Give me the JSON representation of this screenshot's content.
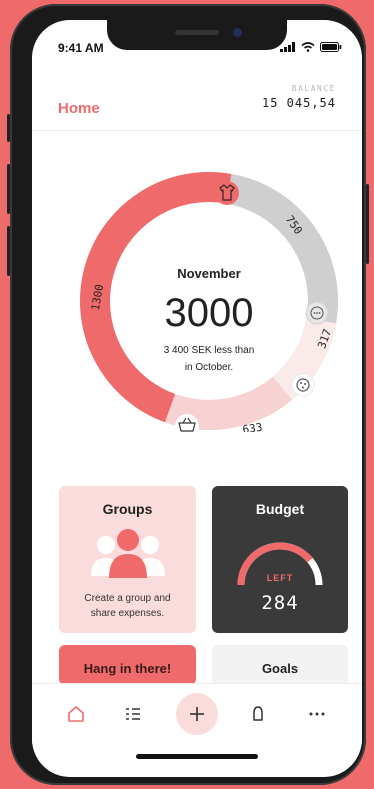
{
  "status": {
    "time": "9:41 AM"
  },
  "header": {
    "title": "Home",
    "balance_label": "BALANCE",
    "balance_value": "15 045,54"
  },
  "overview": {
    "month": "November",
    "amount": "3000",
    "comparison_line1": "3 400 SEK less than",
    "comparison_line2": "in October.",
    "segments": [
      {
        "category": "clothing",
        "value": "1300",
        "icon": "shirt-icon",
        "color": "#ef6b6b"
      },
      {
        "category": "other",
        "value": "750",
        "icon": "more-icon",
        "color": "#cfcfcf"
      },
      {
        "category": "food",
        "value": "317",
        "icon": "food-icon",
        "color": "#fbe9e9"
      },
      {
        "category": "shopping",
        "value": "633",
        "icon": "basket-icon",
        "color": "#f6d2d2"
      }
    ]
  },
  "groups": {
    "title": "Groups",
    "description_line1": "Create a group and",
    "description_line2": "share expenses."
  },
  "budget": {
    "title": "Budget",
    "left_label": "LEFT",
    "left_value": "284",
    "used_fraction": 0.78
  },
  "hang": {
    "title": "Hang in there!"
  },
  "goals": {
    "title": "Goals"
  },
  "tabs": [
    {
      "name": "home-icon",
      "active": true
    },
    {
      "name": "list-icon",
      "active": false
    },
    {
      "name": "add-icon",
      "active": false
    },
    {
      "name": "notification-icon",
      "active": false
    },
    {
      "name": "more-icon",
      "active": false
    }
  ],
  "colors": {
    "accent": "#ef6b6b",
    "dark_card": "#3a3a3a",
    "light_pink": "#fbdcdc"
  }
}
